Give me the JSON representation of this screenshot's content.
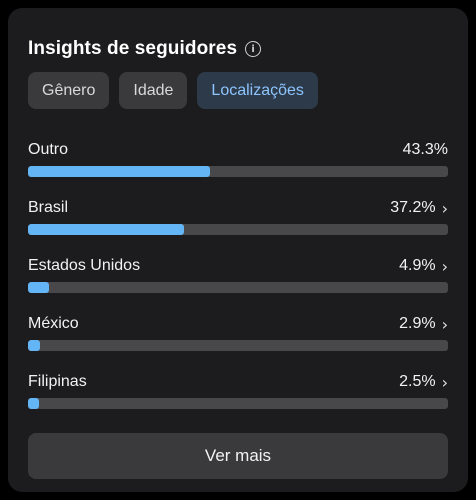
{
  "header": {
    "title": "Insights de seguidores",
    "info_icon": "info-icon"
  },
  "tabs": [
    {
      "label": "Gênero",
      "active": false
    },
    {
      "label": "Idade",
      "active": false
    },
    {
      "label": "Localizações",
      "active": true
    }
  ],
  "locations": [
    {
      "label": "Outro",
      "percent_text": "43.3%",
      "fraction": 0.433,
      "has_chevron": false
    },
    {
      "label": "Brasil",
      "percent_text": "37.2%",
      "fraction": 0.372,
      "has_chevron": true
    },
    {
      "label": "Estados Unidos",
      "percent_text": "4.9%",
      "fraction": 0.049,
      "has_chevron": true
    },
    {
      "label": "México",
      "percent_text": "2.9%",
      "fraction": 0.029,
      "has_chevron": true
    },
    {
      "label": "Filipinas",
      "percent_text": "2.5%",
      "fraction": 0.025,
      "has_chevron": true
    }
  ],
  "more_button": {
    "label": "Ver mais"
  },
  "colors": {
    "accent": "#64b5f6",
    "active_tab_text": "#8ec5ff",
    "card_bg": "#1c1c1e",
    "track": "#48484a"
  }
}
